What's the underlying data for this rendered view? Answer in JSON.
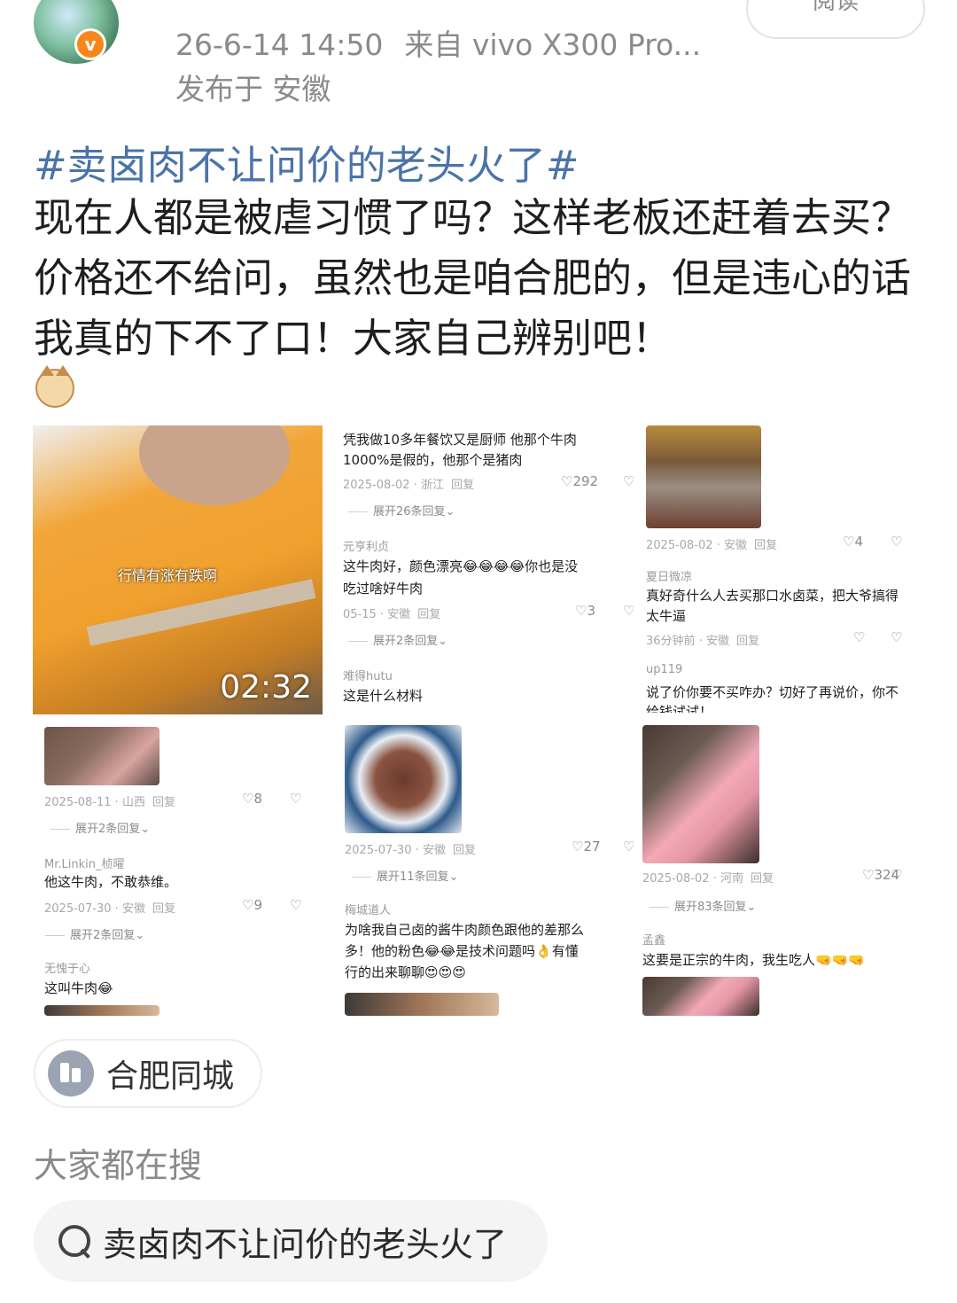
{
  "post": {
    "meta_time": "26-6-14 14:50",
    "meta_source": "来自 vivo X300 Pro...",
    "location": "发布于 安徽",
    "read_label": "阅读",
    "verified_badge": "v",
    "hashtag": "#卖卤肉不让问价的老头火了#",
    "body": "现在人都是被虐习惯了吗？这样老板还赶着去买？价格还不给问，虽然也是咱合肥的，但是违心的话我真的下不了口！大家自己辨别吧！"
  },
  "collage": {
    "video_caption": "行情有涨有跌啊",
    "video_duration": "02:32",
    "col1": {
      "meta1": "2025-08-11 · 山西",
      "reply1": "回复",
      "like1": "♡8",
      "expand1": "展开2条回复⌄",
      "name2": "Mr.Linkin_桢曜",
      "text2": "他这牛肉，不敢恭维。",
      "meta2": "2025-07-30 · 安徽",
      "reply2": "回复",
      "like2": "♡9",
      "expand2": "展开2条回复⌄",
      "name3": "无愧于心",
      "text3": "这叫牛肉😂"
    },
    "col2": {
      "text1a": "凭我做10多年餐饮又是厨师 他那个牛肉",
      "text1b": "1000%是假的，他那个是猪肉",
      "meta1": "2025-08-02 · 浙江",
      "reply1": "回复",
      "like1": "♡292",
      "expand1": "展开26条回复⌄",
      "name2": "元亨利贞",
      "text2a": "这牛肉好，颜色漂亮😂😂😂😂你也是没",
      "text2b": "吃过啥好牛肉",
      "meta2": "05-15 · 安徽",
      "reply2": "回复",
      "like2": "♡3",
      "expand2": "展开2条回复⌄",
      "name3": "难得hutu",
      "text3": "这是什么材料",
      "meta3": "2025-07-30 · 安徽",
      "reply3": "回复",
      "like3": "♡27",
      "expand3": "展开11条回复⌄",
      "name4": "梅城道人",
      "text4a": "为啥我自己卤的酱牛肉颜色跟他的差那么",
      "text4b": "多！他的粉色😂😂是技术问题吗👌有懂",
      "text4c": "行的出来聊聊😍😍😍"
    },
    "col3": {
      "meta1": "2025-08-02 · 安徽",
      "reply1": "回复",
      "like1": "♡4",
      "name2": "夏日微凉",
      "text2a": "真好奇什么人去买那口水卤菜，把大爷搞得",
      "text2b": "太牛逼",
      "meta2": "36分钟前 · 安徽",
      "reply2": "回复",
      "name3": "up119",
      "text3a": "说了价你要不买咋办？切好了再说价，你不",
      "text3b": "给钱试试！",
      "meta3": "2025-08-02 · 河南",
      "reply3": "回复",
      "like3": "♡324",
      "expand3": "展开83条回复⌄",
      "name4": "孟鑫",
      "text4": "这要是正宗的牛肉，我生吃人🤜🤜🤜"
    }
  },
  "tag": {
    "label": "合肥同城"
  },
  "search": {
    "heading": "大家都在搜",
    "query": "卖卤肉不让问价的老头火了"
  },
  "colors": {
    "link": "#4a74a8",
    "verified": "#f7861b",
    "muted": "#8a8a8a"
  },
  "icons": [
    "verified-icon",
    "cat-emoji-icon",
    "city-icon",
    "search-icon",
    "heart-icon",
    "dislike-icon"
  ]
}
